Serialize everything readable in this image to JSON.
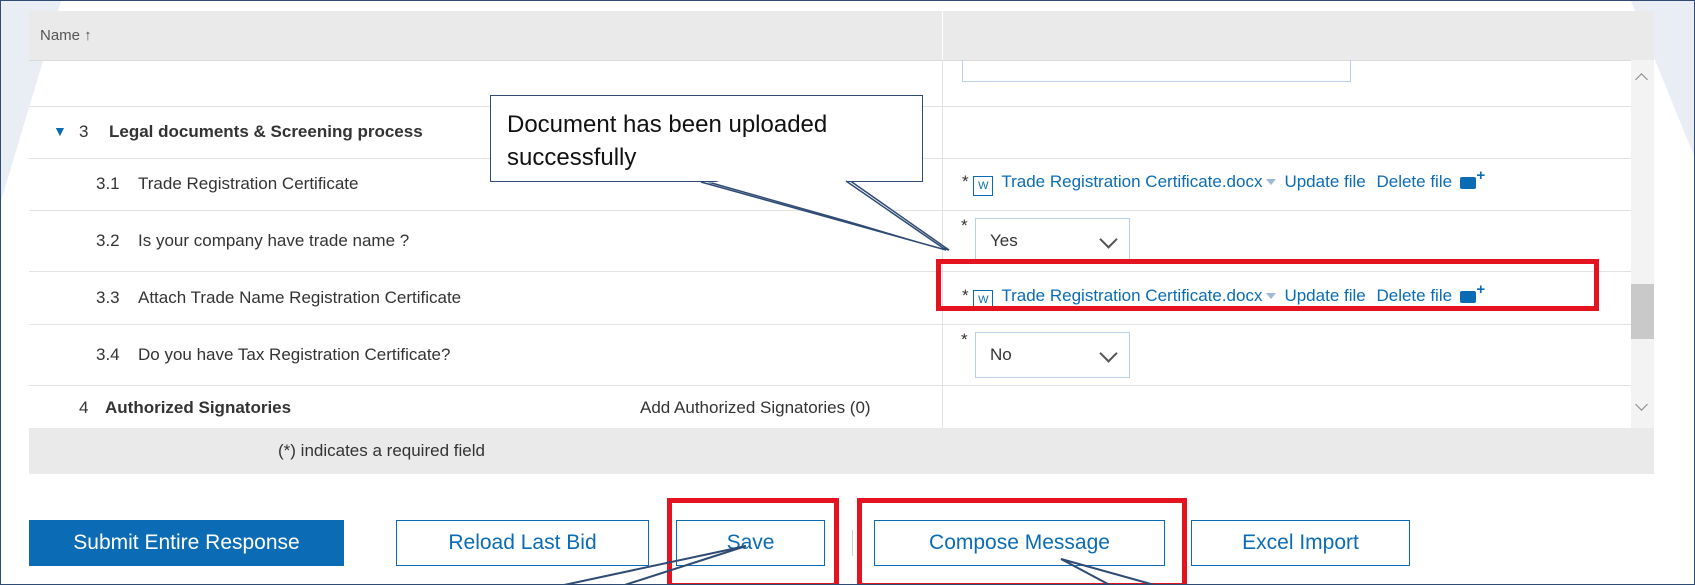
{
  "table": {
    "header_name": "Name ↑"
  },
  "rows": {
    "r3": {
      "number": "3",
      "label": "Legal documents & Screening process"
    },
    "r31": {
      "number": "3.1",
      "label": "Trade Registration Certificate",
      "file": "Trade Registration Certificate.docx",
      "update": "Update file",
      "delete": "Delete file",
      "star": "*"
    },
    "r32": {
      "number": "3.2",
      "label": "Is your company have trade name ?",
      "value": "Yes",
      "star": "*"
    },
    "r33": {
      "number": "3.3",
      "label": "Attach Trade Name Registration Certificate",
      "file": "Trade Registration Certificate.docx",
      "update": "Update file",
      "delete": "Delete file",
      "star": "*"
    },
    "r34": {
      "number": "3.4",
      "label": "Do you have Tax Registration Certificate?",
      "value": "No",
      "star": "*"
    },
    "r4": {
      "number": "4",
      "label": "Authorized Signatories",
      "link": "Add Authorized Signatories (0)"
    }
  },
  "footer": {
    "required_note": "(*) indicates a required field"
  },
  "buttons": {
    "submit": "Submit Entire Response",
    "reload": "Reload Last Bid",
    "save": "Save",
    "compose": "Compose Message",
    "excel": "Excel Import"
  },
  "callout": {
    "text": "Document has been uploaded successfully"
  },
  "icons": {
    "word": "W",
    "expand": "▼"
  },
  "colors": {
    "accent": "#0b6cb5",
    "highlight": "#e3141f",
    "callout_border": "#2f4a73"
  }
}
